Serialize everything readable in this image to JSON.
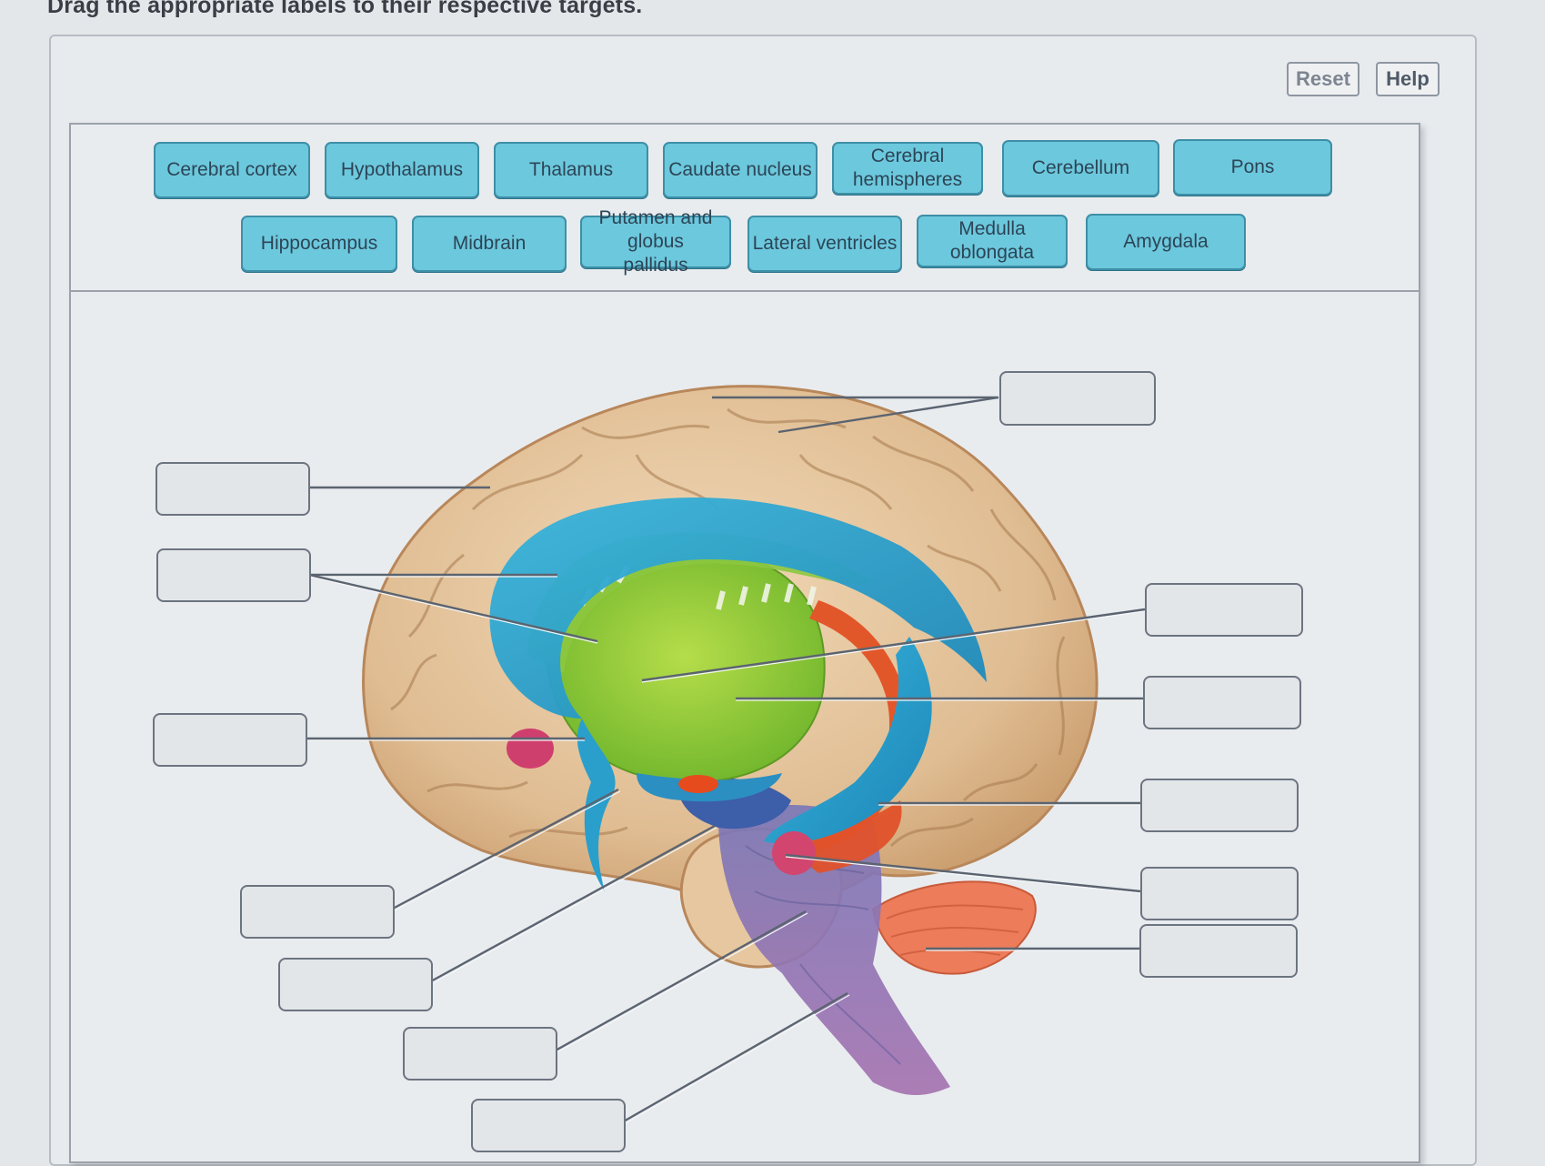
{
  "instructions": "Drag the appropriate labels to their respective targets.",
  "toolbar": {
    "reset_label": "Reset",
    "help_label": "Help"
  },
  "label_bank": {
    "row1": [
      {
        "id": "cerebral-cortex",
        "text": "Cerebral cortex"
      },
      {
        "id": "hypothalamus",
        "text": "Hypothalamus"
      },
      {
        "id": "thalamus",
        "text": "Thalamus"
      },
      {
        "id": "caudate-nucleus",
        "text": "Caudate nucleus"
      },
      {
        "id": "cerebral-hemispheres",
        "text": "Cerebral hemispheres"
      },
      {
        "id": "cerebellum",
        "text": "Cerebellum"
      },
      {
        "id": "pons",
        "text": "Pons"
      }
    ],
    "row2": [
      {
        "id": "hippocampus",
        "text": "Hippocampus"
      },
      {
        "id": "midbrain",
        "text": "Midbrain"
      },
      {
        "id": "putamen-globus-pallidus",
        "text": "Putamen and globus pallidus"
      },
      {
        "id": "lateral-ventricles",
        "text": "Lateral ventricles"
      },
      {
        "id": "medulla-oblongata",
        "text": "Medulla oblongata"
      },
      {
        "id": "amygdala",
        "text": "Amygdala"
      }
    ]
  },
  "targets": {
    "count": 13,
    "filled": []
  },
  "diagram": {
    "subject": "brain-sagittal-structures",
    "colors": {
      "cortex": "#e3c29b",
      "ventricles": "#2aa5cf",
      "basal_nuclei": "#9fd13a",
      "hippocampus_tract": "#e2572a",
      "amygdala": "#cf3f6e",
      "brainstem": "#8c76b5",
      "cerebellum_accent": "#ec7c5a"
    }
  },
  "colors": {
    "label_fill": "#6cc8dd",
    "label_border": "#3d8fa6",
    "target_border": "#6c7480"
  }
}
